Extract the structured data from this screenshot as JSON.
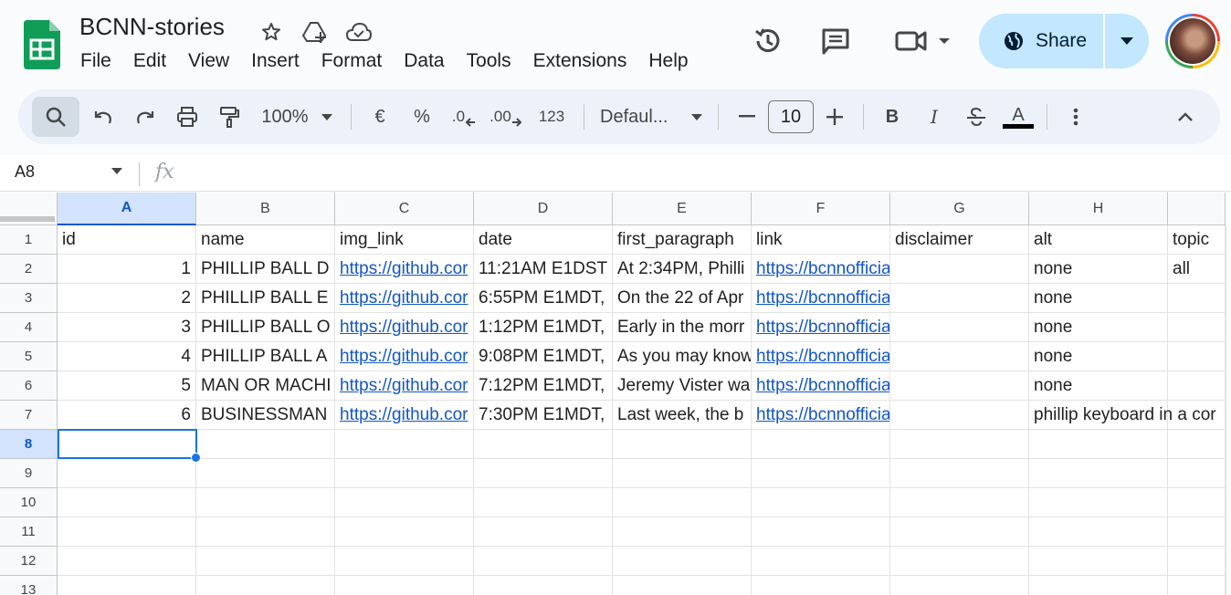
{
  "app": {
    "doc_title": "BCNN-stories",
    "menus": [
      "File",
      "Edit",
      "View",
      "Insert",
      "Format",
      "Data",
      "Tools",
      "Extensions",
      "Help"
    ],
    "share_label": "Share"
  },
  "toolbar": {
    "zoom": "100%",
    "currency": "€",
    "percent": "%",
    "dec_decrease": ".0",
    "dec_increase": ".00",
    "number_format": "123",
    "font": "Defaul...",
    "font_size": "10",
    "bold": "B",
    "italic": "I",
    "text_color_letter": "A"
  },
  "formula_bar": {
    "cell_ref": "A8",
    "fx": "fx",
    "value": ""
  },
  "sheet": {
    "columns": [
      "A",
      "B",
      "C",
      "D",
      "E",
      "F",
      "G",
      "H"
    ],
    "rows": [
      "1",
      "2",
      "3",
      "4",
      "5",
      "6",
      "7",
      "8",
      "9",
      "10",
      "11",
      "12",
      "13"
    ],
    "selected_col": "A",
    "selected_row": "8",
    "header_row": [
      "id",
      "name",
      "img_link",
      "date",
      "first_paragraph",
      "link",
      "disclaimer",
      "alt",
      "topic"
    ],
    "data": [
      [
        "1",
        "PHILLIP BALL D",
        "https://github.cor",
        "11:21AM E1DST",
        "At 2:34PM, Philli",
        "https://bcnnofficia",
        "",
        "none",
        "all"
      ],
      [
        "2",
        "PHILLIP BALL E",
        "https://github.cor",
        "6:55PM E1MDT,",
        "On the 22 of Apr",
        "https://bcnnofficia",
        "",
        "none",
        ""
      ],
      [
        "3",
        "PHILLIP BALL O",
        "https://github.cor",
        "1:12PM E1MDT,",
        "Early in the morr",
        "https://bcnnofficia",
        "",
        "none",
        ""
      ],
      [
        "4",
        "PHILLIP BALL A",
        "https://github.cor",
        "9:08PM E1MDT,",
        "As you may know",
        "https://bcnnofficia",
        "",
        "none",
        ""
      ],
      [
        "5",
        "MAN OR MACHI",
        "https://github.cor",
        "7:12PM E1MDT,",
        "Jeremy Vister wa",
        "https://bcnnofficia",
        "",
        "none",
        ""
      ],
      [
        "6",
        "BUSINESSMAN",
        "https://github.cor",
        "7:30PM E1MDT,",
        "Last week, the b",
        "https://bcnnofficia",
        "",
        "phillip keyboard in a cor",
        ""
      ]
    ]
  },
  "colors": {
    "accent": "#0b57d0",
    "share_bg": "#c2e7ff",
    "link": "#1155cc",
    "logo_green": "#0f9d58"
  }
}
